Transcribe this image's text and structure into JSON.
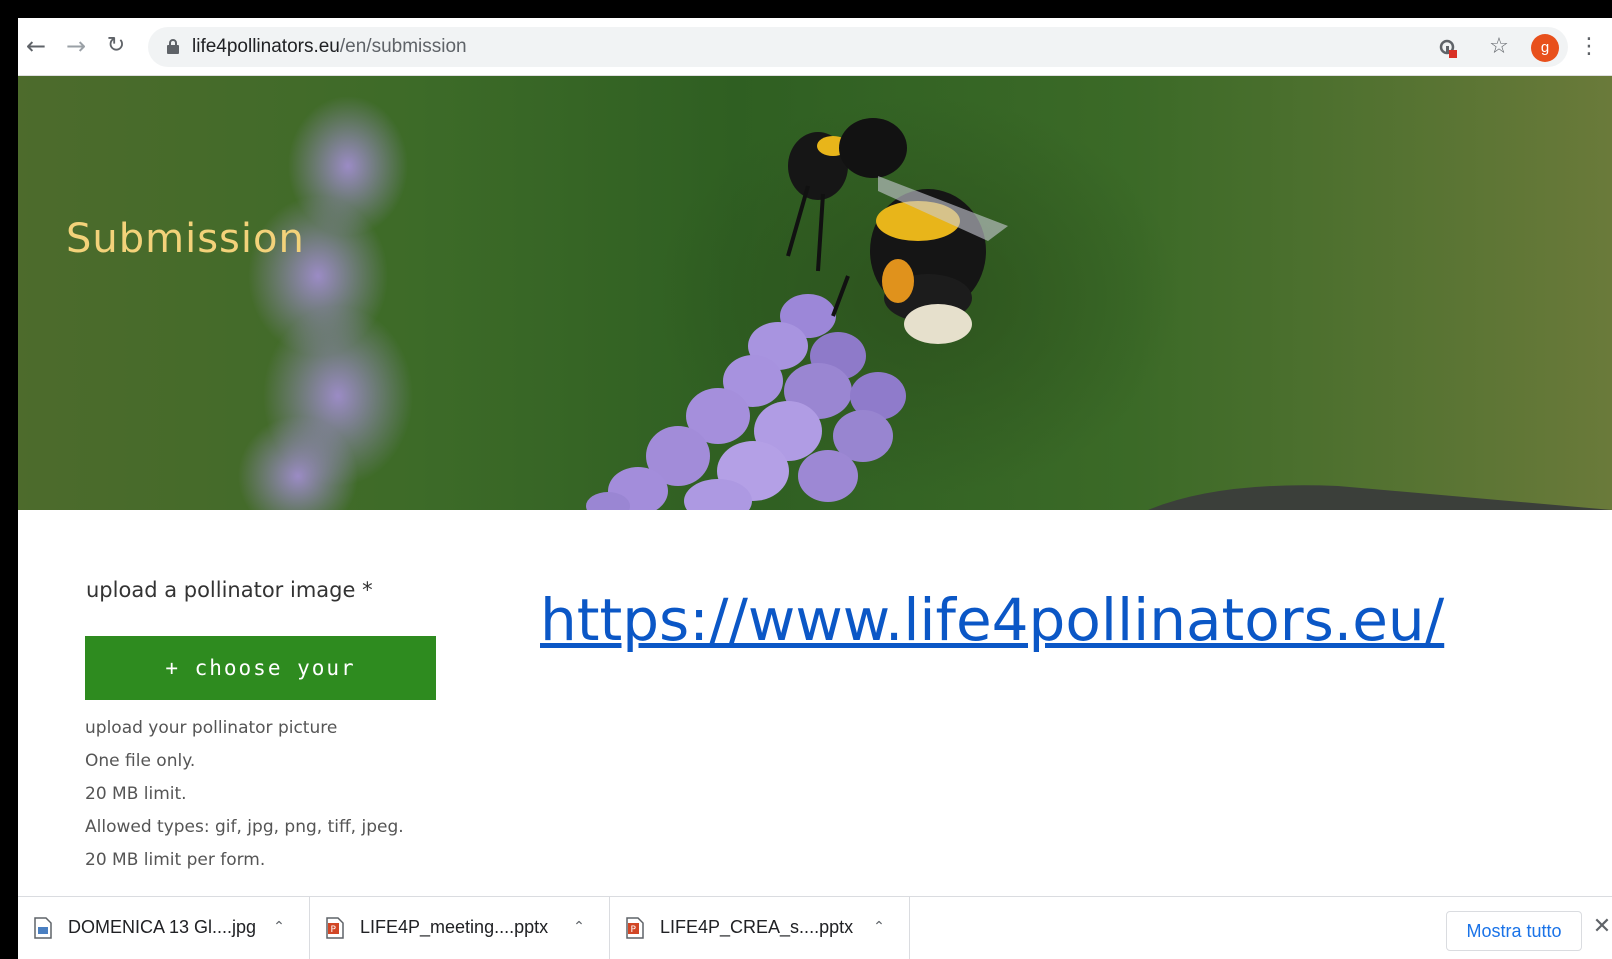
{
  "browser": {
    "url_domain": "life4pollinators.eu",
    "url_path": "/en/submission",
    "avatar_initial": "g",
    "icons": [
      "back-arrow",
      "forward-arrow",
      "reload",
      "lock",
      "extension",
      "star",
      "menu-dots"
    ]
  },
  "hero": {
    "title": "Submission"
  },
  "form": {
    "upload_label": "upload a pollinator image *",
    "choose_button": "+ choose your picture...",
    "help_lines": [
      "upload your pollinator picture",
      "One file only.",
      "20 MB limit.",
      "Allowed types: gif, jpg, png, tiff, jpeg.",
      "20 MB limit per form."
    ]
  },
  "overlay_link": {
    "text": "https://www.life4pollinators.eu/"
  },
  "downloads": {
    "items": [
      {
        "name": "DOMENICA 13 Gl....jpg",
        "type": "image"
      },
      {
        "name": "LIFE4P_meeting....pptx",
        "type": "powerpoint"
      },
      {
        "name": "LIFE4P_CREA_s....pptx",
        "type": "powerpoint"
      }
    ],
    "show_all": "Mostra tutto"
  },
  "colors": {
    "button_green": "#2e8b1f",
    "title_yellow": "#f3d27a",
    "link_blue": "#0b57c6",
    "show_all_blue": "#1a73e8"
  }
}
